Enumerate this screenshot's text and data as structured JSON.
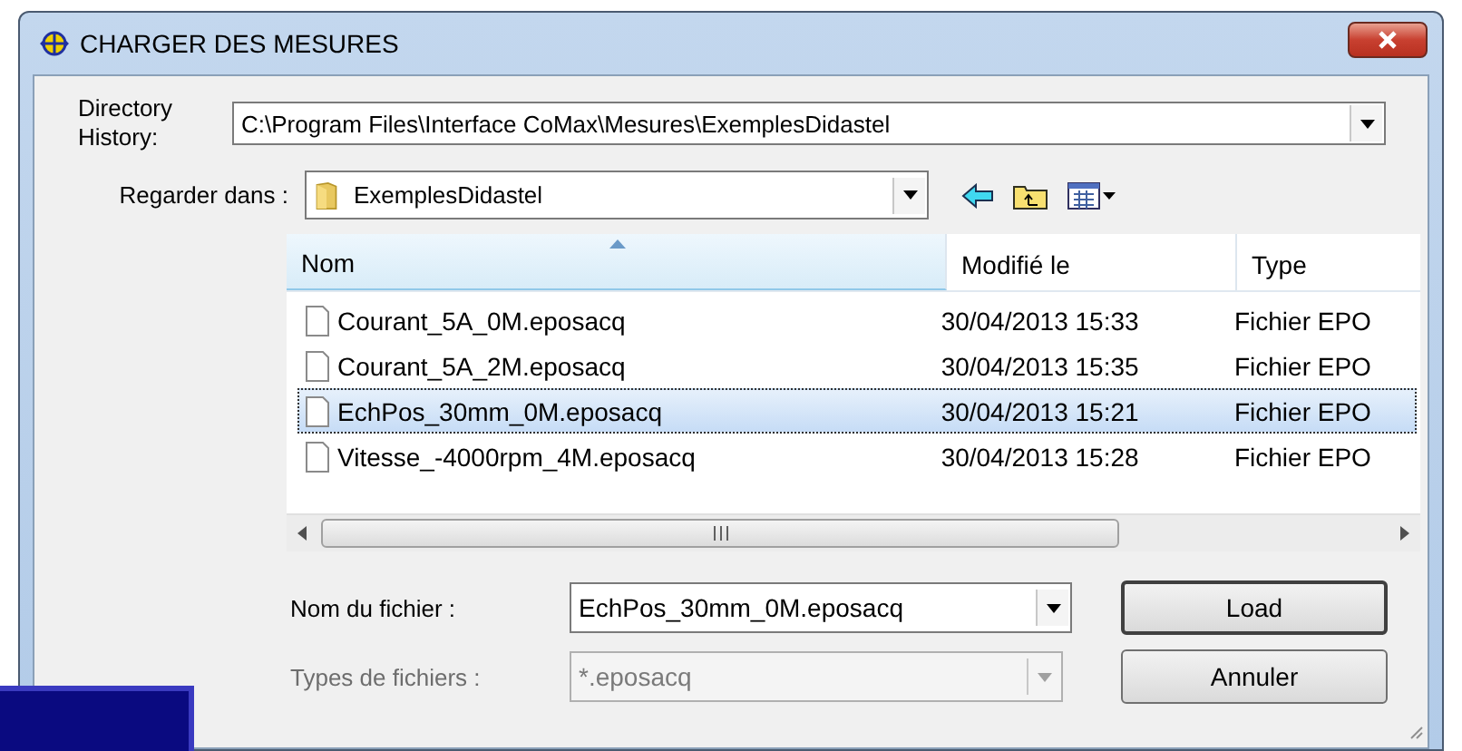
{
  "window": {
    "title": "CHARGER DES MESURES"
  },
  "directory_history": {
    "label": "Directory History:",
    "value": "C:\\Program Files\\Interface CoMax\\Mesures\\ExemplesDidastel"
  },
  "look_in": {
    "label": "Regarder dans :",
    "value": "ExemplesDidastel"
  },
  "file_list": {
    "columns": [
      {
        "label": "Nom",
        "sorted": true
      },
      {
        "label": "Modifié le",
        "sorted": false
      },
      {
        "label": "Type",
        "sorted": false
      }
    ],
    "rows": [
      {
        "name": "Courant_5A_0M.eposacq",
        "modified": "30/04/2013 15:33",
        "type": "Fichier EPO",
        "selected": false
      },
      {
        "name": "Courant_5A_2M.eposacq",
        "modified": "30/04/2013 15:35",
        "type": "Fichier EPO",
        "selected": false
      },
      {
        "name": "EchPos_30mm_0M.eposacq",
        "modified": "30/04/2013 15:21",
        "type": "Fichier EPO",
        "selected": true
      },
      {
        "name": "Vitesse_-4000rpm_4M.eposacq",
        "modified": "30/04/2013 15:28",
        "type": "Fichier EPO",
        "selected": false
      }
    ]
  },
  "file_name": {
    "label": "Nom du fichier :",
    "value": "EchPos_30mm_0M.eposacq",
    "disabled": false
  },
  "file_type": {
    "label": "Types de fichiers :",
    "value": "*.eposacq",
    "disabled": true
  },
  "buttons": [
    {
      "label": "Load",
      "default": true
    },
    {
      "label": "Annuler",
      "default": false
    }
  ]
}
